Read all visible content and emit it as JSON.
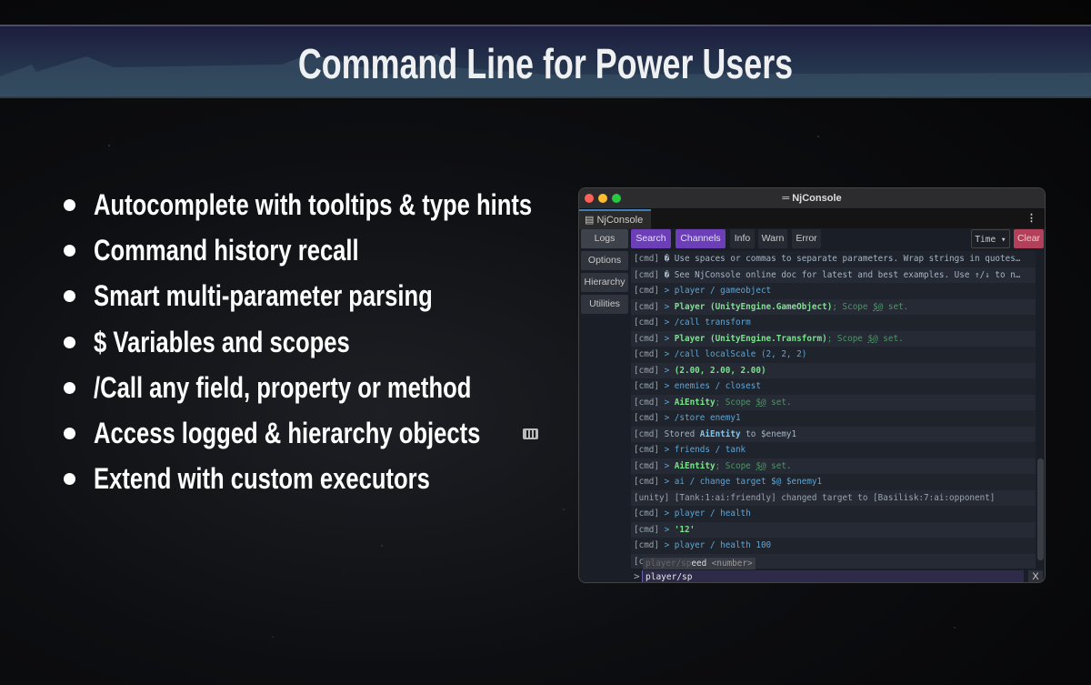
{
  "slide": {
    "title": "Command Line for Power Users",
    "bullets": [
      "Autocomplete with tooltips & type hints",
      "Command history recall",
      "Smart multi-parameter parsing",
      "$ Variables and scopes",
      "/Call any field, property or method",
      "Access logged & hierarchy objects",
      "Extend with custom executors"
    ]
  },
  "window": {
    "title": "═ NjConsole",
    "tab": "NjConsole",
    "menu": "⋮",
    "sidebar": [
      "Logs",
      "Options",
      "Hierarchy",
      "Utilities"
    ],
    "toolbar": {
      "search": "Search",
      "channels": "Channels",
      "info": "Info",
      "warn": "Warn",
      "error": "Error",
      "time": "Time ▾",
      "clear": "Clear"
    },
    "colors": {
      "purple": "#6c3fb8",
      "clear": "#b3405a",
      "input": "#5ea6d6",
      "result": "#7fe090"
    },
    "logs": [
      [
        [
          "p",
          "[cmd] "
        ],
        [
          "plain",
          "� Use spaces or commas to separate parameters. Wrap strings in quotes…"
        ]
      ],
      [
        [
          "p",
          "[cmd] "
        ],
        [
          "plain",
          "� See NjConsole online doc for latest and best examples. Use ↑/↓ to n…"
        ]
      ],
      [
        [
          "p",
          "[cmd] "
        ],
        [
          "in",
          "> player / gameobject"
        ]
      ],
      [
        [
          "p",
          "[cmd] "
        ],
        [
          "in",
          "> "
        ],
        [
          "res",
          "Player (UnityEngine.GameObject)"
        ],
        [
          "dim",
          "; Scope "
        ],
        [
          "dim u",
          "$@"
        ],
        [
          "dim",
          " set."
        ]
      ],
      [
        [
          "p",
          "[cmd] "
        ],
        [
          "in",
          "> /call transform"
        ]
      ],
      [
        [
          "p",
          "[cmd] "
        ],
        [
          "in",
          "> "
        ],
        [
          "res",
          "Player (UnityEngine.Transform)"
        ],
        [
          "dim",
          "; Scope "
        ],
        [
          "dim u",
          "$@"
        ],
        [
          "dim",
          " set."
        ]
      ],
      [
        [
          "p",
          "[cmd] "
        ],
        [
          "in",
          "> /call localScale (2, 2, 2)"
        ]
      ],
      [
        [
          "p",
          "[cmd] "
        ],
        [
          "in",
          "> "
        ],
        [
          "res",
          "(2.00, 2.00, 2.00)"
        ]
      ],
      [
        [
          "p",
          "[cmd] "
        ],
        [
          "in",
          "> enemies / closest"
        ]
      ],
      [
        [
          "p",
          "[cmd] "
        ],
        [
          "in",
          "> "
        ],
        [
          "res",
          "AiEntity"
        ],
        [
          "dim",
          "; Scope "
        ],
        [
          "dim u",
          "$@"
        ],
        [
          "dim",
          " set."
        ]
      ],
      [
        [
          "p",
          "[cmd] "
        ],
        [
          "in",
          "> /store enemy1"
        ]
      ],
      [
        [
          "p",
          "[cmd] "
        ],
        [
          "plain",
          "Stored "
        ],
        [
          "resb",
          "AiEntity"
        ],
        [
          "plain",
          " to $enemy1"
        ]
      ],
      [
        [
          "p",
          "[cmd] "
        ],
        [
          "in",
          "> friends / tank"
        ]
      ],
      [
        [
          "p",
          "[cmd] "
        ],
        [
          "in",
          "> "
        ],
        [
          "res",
          "AiEntity"
        ],
        [
          "dim",
          "; Scope "
        ],
        [
          "dim u",
          "$@"
        ],
        [
          "dim",
          " set."
        ]
      ],
      [
        [
          "p",
          "[cmd] "
        ],
        [
          "in",
          "> ai / change target $@ $enemy1"
        ]
      ],
      [
        [
          "p",
          "[unity] [Tank:1:ai:friendly] changed target to [Basilisk:7:ai:opponent]"
        ]
      ],
      [
        [
          "p",
          "[cmd] "
        ],
        [
          "in",
          "> player / health"
        ]
      ],
      [
        [
          "p",
          "[cmd] "
        ],
        [
          "in",
          "> "
        ],
        [
          "res",
          "'12'"
        ]
      ],
      [
        [
          "p",
          "[cmd] "
        ],
        [
          "in",
          "> player / health 100"
        ]
      ],
      [
        [
          "p",
          "[c"
        ]
      ]
    ],
    "autocomplete": {
      "typed": "player/sp",
      "completion": "eed",
      "hint": "<number>"
    },
    "input": {
      "prompt": ">",
      "value": "player/sp",
      "close": "X"
    }
  }
}
